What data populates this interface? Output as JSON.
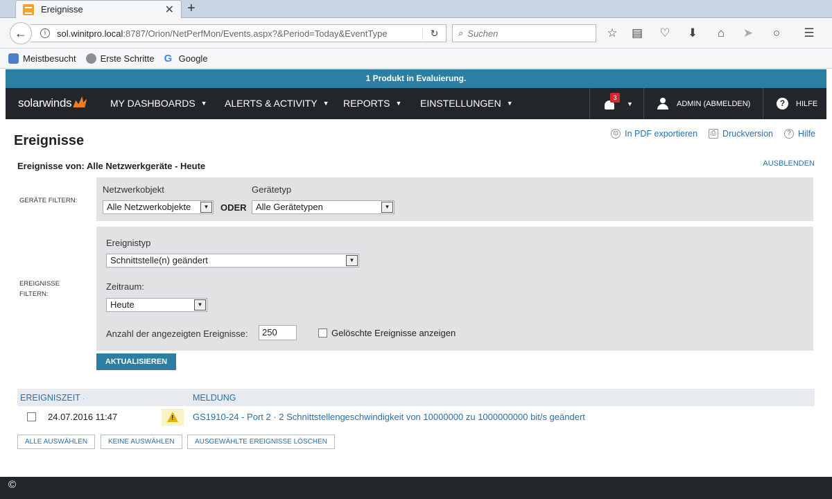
{
  "browser": {
    "tab_title": "Ereignisse",
    "url_host": "sol.winitpro.local",
    "url_rest": ":8787/Orion/NetPerfMon/Events.aspx?&Period=Today&EventType",
    "search_placeholder": "Suchen",
    "bookmarks": [
      "Meistbesucht",
      "Erste Schritte",
      "Google"
    ]
  },
  "eval_banner": "1 Produkt in Evaluierung.",
  "appnav": {
    "logo": "solarwinds",
    "items": [
      "MY DASHBOARDS",
      "ALERTS & ACTIVITY",
      "REPORTS",
      "EINSTELLUNGEN"
    ],
    "notification_count": "3",
    "user": "ADMIN  (ABMELDEN)",
    "help": "HILFE"
  },
  "page": {
    "title": "Ereignisse",
    "links": [
      "In PDF exportieren",
      "Druckversion",
      "Hilfe"
    ],
    "subtitle": "Ereignisse von: Alle Netzwerkgeräte - Heute",
    "hide": "AUSBLENDEN"
  },
  "device_filter": {
    "label_line1": "GERÄTE FILTERN:",
    "netobj_label": "Netzwerkobjekt",
    "netobj_value": "Alle Netzwerkobjekte",
    "or": "ODER",
    "devtype_label": "Gerätetyp",
    "devtype_value": "Alle Gerätetypen"
  },
  "event_filter": {
    "label_line1": "EREIGNISSE",
    "label_line2": "FILTERN:",
    "type_label": "Ereignistyp",
    "type_value": "Schnittstelle(n) geändert",
    "period_label": "Zeitraum:",
    "period_value": "Heute",
    "count_label": "Anzahl der angezeigten Ereignisse:",
    "count_value": "250",
    "deleted_label": "Gelöschte Ereignisse anzeigen"
  },
  "update_button": "AKTUALISIEREN",
  "table": {
    "headers": [
      "EREIGNISZEIT",
      "MELDUNG"
    ],
    "rows": [
      {
        "time": "24.07.2016 11:47",
        "message": "GS1910-24 - Port 2 · 2 Schnittstellengeschwindigkeit von 10000000 zu 1000000000 bit/s geändert"
      }
    ]
  },
  "buttons": {
    "select_all": "ALLE AUSWÄHLEN",
    "select_none": "KEINE AUSWÄHLEN",
    "delete_selected": "AUSGEWÄHLTE EREIGNISSE LÖSCHEN"
  },
  "footer": {
    "copyright": "©"
  },
  "colors": {
    "accent": "#2b7fa3",
    "nav_bg": "#22262b",
    "link": "#2a6fa8"
  }
}
